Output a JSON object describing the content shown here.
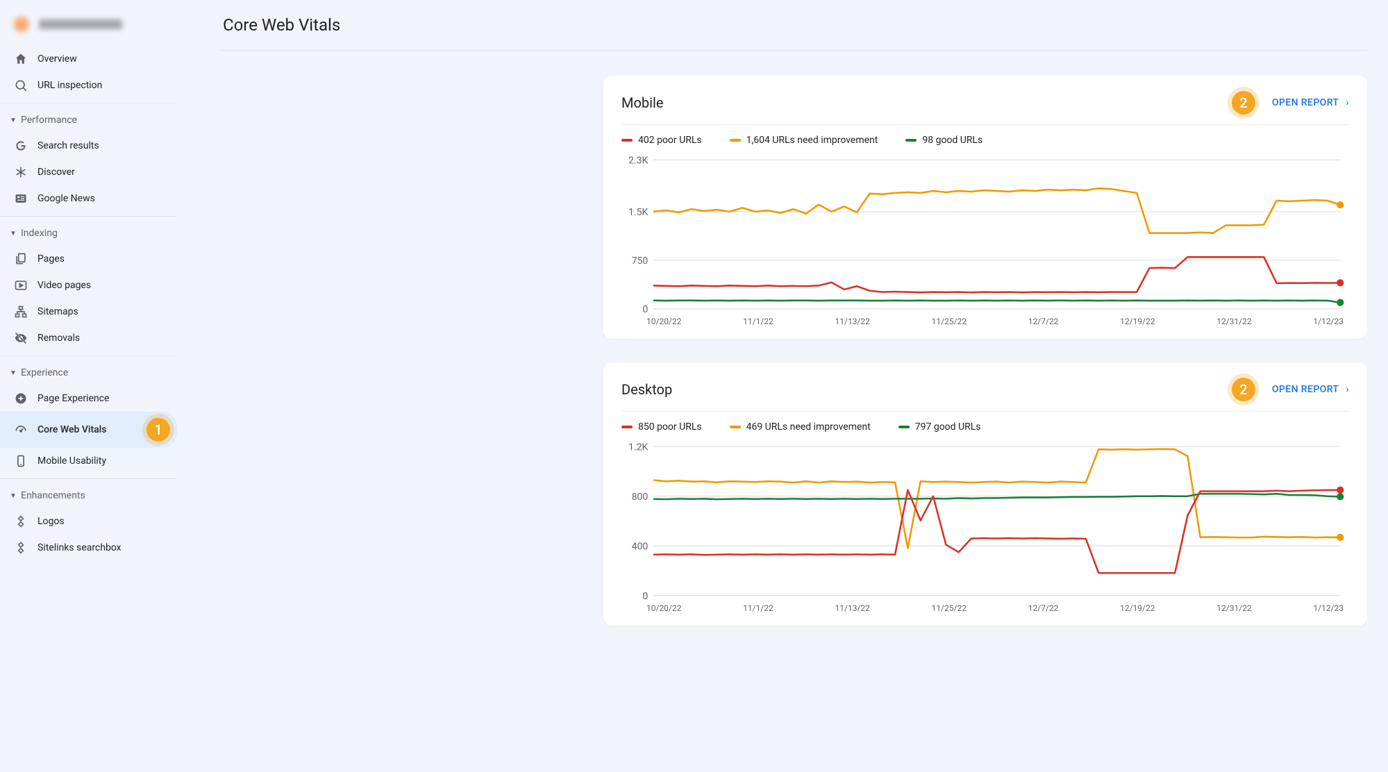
{
  "colors": {
    "poor": "#d93025",
    "need": "#f29900",
    "good": "#188038",
    "axis": "#9aa0a6",
    "grid": "#e0e0e0",
    "link": "#1a73e8"
  },
  "page_title": "Core Web Vitals",
  "annot": {
    "sidebar_badge": "1",
    "open_report_badge": "2"
  },
  "open_report_label": "OPEN REPORT",
  "sidebar": {
    "top": [
      {
        "icon": "home",
        "label": "Overview"
      },
      {
        "icon": "search",
        "label": "URL inspection"
      }
    ],
    "sections": [
      {
        "header": "Performance",
        "items": [
          {
            "icon": "g",
            "label": "Search results"
          },
          {
            "icon": "asterisk",
            "label": "Discover"
          },
          {
            "icon": "news",
            "label": "Google News"
          }
        ]
      },
      {
        "header": "Indexing",
        "items": [
          {
            "icon": "pages",
            "label": "Pages"
          },
          {
            "icon": "video",
            "label": "Video pages"
          },
          {
            "icon": "sitemaps",
            "label": "Sitemaps"
          },
          {
            "icon": "removals",
            "label": "Removals"
          }
        ]
      },
      {
        "header": "Experience",
        "items": [
          {
            "icon": "plus",
            "label": "Page Experience"
          },
          {
            "icon": "speed",
            "label": "Core Web Vitals",
            "active": true,
            "badge": "1"
          },
          {
            "icon": "mobile",
            "label": "Mobile Usability"
          }
        ]
      },
      {
        "header": "Enhancements",
        "items": [
          {
            "icon": "diamond",
            "label": "Logos"
          },
          {
            "icon": "diamond",
            "label": "Sitelinks searchbox"
          }
        ]
      }
    ]
  },
  "x_dates": [
    "10/20/22",
    "11/1/22",
    "11/13/22",
    "11/25/22",
    "12/7/22",
    "12/19/22",
    "12/31/22",
    "1/12/23"
  ],
  "chart_data": [
    {
      "title": "Mobile",
      "type": "line",
      "ylim": [
        0,
        2300
      ],
      "yticks": [
        0,
        750,
        1500,
        2300
      ],
      "yticklabels": [
        "0",
        "750",
        "1.5K",
        "2.3K"
      ],
      "legend": [
        {
          "key": "poor",
          "label": "402 poor URLs"
        },
        {
          "key": "need",
          "label": "1,604 URLs need improvement"
        },
        {
          "key": "good",
          "label": "98 good URLs"
        }
      ],
      "series": {
        "need": [
          1500,
          1520,
          1490,
          1540,
          1510,
          1530,
          1500,
          1560,
          1500,
          1520,
          1480,
          1540,
          1470,
          1610,
          1500,
          1580,
          1490,
          1780,
          1770,
          1790,
          1800,
          1790,
          1820,
          1800,
          1820,
          1810,
          1830,
          1820,
          1810,
          1830,
          1820,
          1840,
          1830,
          1840,
          1830,
          1860,
          1850,
          1820,
          1790,
          1170,
          1170,
          1170,
          1170,
          1180,
          1170,
          1290,
          1290,
          1290,
          1300,
          1670,
          1660,
          1670,
          1680,
          1670,
          1604
        ],
        "poor": [
          360,
          355,
          350,
          360,
          355,
          350,
          360,
          355,
          350,
          360,
          350,
          355,
          350,
          360,
          410,
          300,
          350,
          280,
          260,
          265,
          260,
          255,
          260,
          258,
          260,
          255,
          260,
          258,
          260,
          255,
          260,
          258,
          260,
          258,
          260,
          258,
          260,
          260,
          260,
          630,
          635,
          630,
          800,
          800,
          800,
          800,
          800,
          800,
          800,
          395,
          400,
          398,
          402,
          400,
          402
        ],
        "good": [
          130,
          128,
          130,
          130,
          128,
          130,
          128,
          130,
          128,
          130,
          128,
          130,
          130,
          128,
          130,
          130,
          130,
          128,
          128,
          130,
          128,
          130,
          128,
          128,
          130,
          128,
          130,
          128,
          130,
          128,
          130,
          128,
          130,
          128,
          130,
          128,
          130,
          128,
          130,
          128,
          128,
          128,
          130,
          128,
          130,
          128,
          130,
          128,
          130,
          128,
          130,
          128,
          130,
          128,
          98
        ]
      }
    },
    {
      "title": "Desktop",
      "type": "line",
      "ylim": [
        0,
        1200
      ],
      "yticks": [
        0,
        400,
        800,
        1200
      ],
      "yticklabels": [
        "0",
        "400",
        "800",
        "1.2K"
      ],
      "legend": [
        {
          "key": "poor",
          "label": "850 poor URLs"
        },
        {
          "key": "need",
          "label": "469 URLs need improvement"
        },
        {
          "key": "good",
          "label": "797 good URLs"
        }
      ],
      "series": {
        "need": [
          930,
          920,
          925,
          918,
          920,
          912,
          920,
          918,
          915,
          920,
          918,
          910,
          920,
          910,
          920,
          915,
          918,
          910,
          915,
          912,
          382,
          920,
          915,
          918,
          915,
          910,
          915,
          918,
          910,
          918,
          915,
          910,
          918,
          915,
          910,
          1178,
          1175,
          1178,
          1175,
          1178,
          1180,
          1178,
          1122,
          470,
          472,
          470,
          468,
          468,
          475,
          472,
          470,
          472,
          468,
          470,
          469
        ],
        "good": [
          778,
          776,
          780,
          778,
          780,
          776,
          778,
          780,
          778,
          780,
          778,
          780,
          778,
          780,
          778,
          780,
          778,
          780,
          778,
          780,
          780,
          780,
          782,
          780,
          785,
          782,
          785,
          786,
          788,
          790,
          790,
          790,
          792,
          794,
          794,
          796,
          796,
          798,
          800,
          800,
          802,
          800,
          800,
          820,
          820,
          820,
          820,
          818,
          815,
          820,
          810,
          810,
          808,
          800,
          797
        ],
        "poor": [
          330,
          332,
          330,
          332,
          328,
          330,
          332,
          330,
          332,
          330,
          332,
          330,
          332,
          330,
          332,
          330,
          332,
          330,
          332,
          330,
          850,
          605,
          800,
          410,
          350,
          460,
          462,
          460,
          462,
          460,
          462,
          460,
          458,
          460,
          458,
          182,
          182,
          182,
          182,
          182,
          182,
          182,
          645,
          840,
          840,
          840,
          840,
          840,
          840,
          845,
          840,
          845,
          848,
          850,
          850
        ]
      }
    }
  ]
}
